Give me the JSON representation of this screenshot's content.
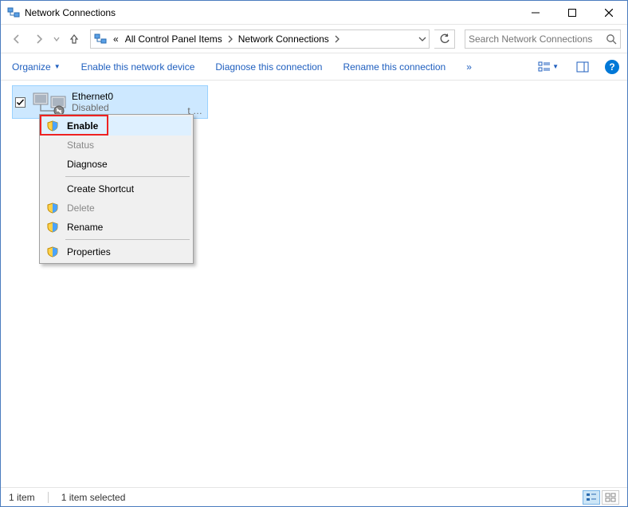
{
  "titlebar": {
    "title": "Network Connections"
  },
  "nav": {
    "crumb_root": "«",
    "crumb1": "All Control Panel Items",
    "crumb2": "Network Connections"
  },
  "search": {
    "placeholder": "Search Network Connections"
  },
  "toolbar": {
    "organize": "Organize",
    "enable_device": "Enable this network device",
    "diagnose_conn": "Diagnose this connection",
    "rename_conn": "Rename this connection",
    "more": "»"
  },
  "connection": {
    "name": "Ethernet0",
    "status": "Disabled",
    "extra": "t …"
  },
  "ctx": {
    "enable": "Enable",
    "status": "Status",
    "diagnose": "Diagnose",
    "create_shortcut": "Create Shortcut",
    "delete": "Delete",
    "rename": "Rename",
    "properties": "Properties"
  },
  "statusbar": {
    "count": "1 item",
    "selected": "1 item selected"
  }
}
